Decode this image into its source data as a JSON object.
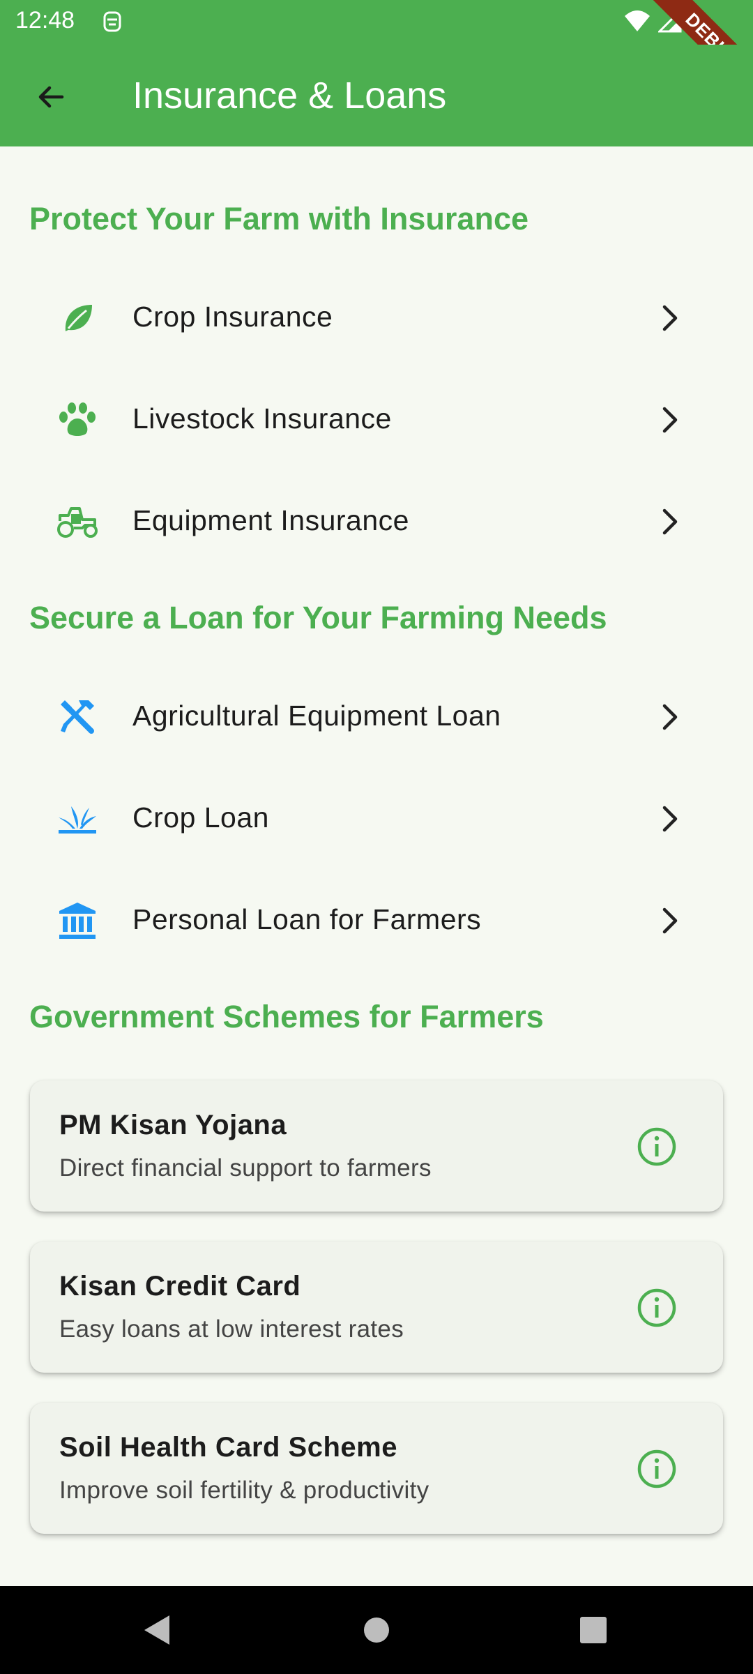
{
  "status": {
    "time": "12:48"
  },
  "appbar": {
    "title": "Insurance & Loans"
  },
  "debug": {
    "label": "DEBUG"
  },
  "insurance": {
    "title": "Protect Your Farm with Insurance",
    "items": [
      {
        "label": "Crop Insurance",
        "icon": "leaf-icon"
      },
      {
        "label": "Livestock Insurance",
        "icon": "paw-icon"
      },
      {
        "label": "Equipment Insurance",
        "icon": "tractor-icon"
      }
    ]
  },
  "loans": {
    "title": "Secure a Loan for Your Farming Needs",
    "items": [
      {
        "label": "Agricultural Equipment Loan",
        "icon": "tools-icon"
      },
      {
        "label": "Crop Loan",
        "icon": "grass-icon"
      },
      {
        "label": "Personal Loan for Farmers",
        "icon": "bank-icon"
      }
    ]
  },
  "schemes": {
    "title": "Government Schemes for Farmers",
    "items": [
      {
        "title": "PM Kisan Yojana",
        "subtitle": "Direct financial support to farmers"
      },
      {
        "title": "Kisan Credit Card",
        "subtitle": "Easy loans at low interest rates"
      },
      {
        "title": "Soil Health Card Scheme",
        "subtitle": "Improve soil fertility & productivity"
      }
    ]
  },
  "colors": {
    "primary": "#4CAF50",
    "loan_icon": "#2196F3",
    "background": "#F6F9F2"
  }
}
